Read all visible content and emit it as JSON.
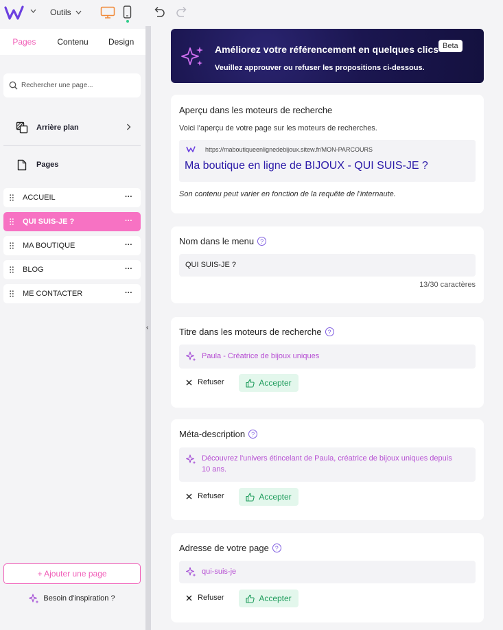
{
  "topbar": {
    "tools_label": "Outils"
  },
  "sidebar": {
    "tabs": [
      {
        "label": "Pages"
      },
      {
        "label": "Contenu"
      },
      {
        "label": "Design"
      }
    ],
    "search_placeholder": "Rechercher une page...",
    "background_label": "Arrière plan",
    "pages_label": "Pages",
    "pages": [
      {
        "label": "ACCUEIL"
      },
      {
        "label": "QUI SUIS-JE ?"
      },
      {
        "label": "MA BOUTIQUE"
      },
      {
        "label": "BLOG"
      },
      {
        "label": "ME CONTACTER"
      }
    ],
    "add_page_label": "+ Ajouter une page",
    "inspiration_label": "Besoin d'inspiration ?"
  },
  "banner": {
    "title": "Améliorez votre référencement en quelques clics",
    "subtitle": "Veuillez approuver ou refuser les propositions ci-dessous.",
    "badge": "Beta"
  },
  "preview_card": {
    "title": "Aperçu dans les moteurs de recherche",
    "description": "Voici l'aperçu de votre page sur les moteurs de recherches.",
    "url": "https://maboutiqueenlignedebijoux.sitew.fr/MON-PARCOURS",
    "page_title": "Ma boutique en ligne de BIJOUX - QUI SUIS-JE ?",
    "note": "Son contenu peut varier en fonction de la requête de l'internaute."
  },
  "menu_name_card": {
    "title": "Nom dans le menu",
    "value": "QUI SUIS-JE ?",
    "counter": "13/30 caractères"
  },
  "seo_title_card": {
    "title": "Titre dans les moteurs de recherche",
    "suggestion": "Paula - Créatrice de bijoux uniques",
    "refuse_label": "Refuser",
    "accept_label": "Accepter"
  },
  "meta_card": {
    "title": "Méta-description",
    "suggestion": "Découvrez l'univers étincelant de Paula, créatrice de bijoux uniques depuis 10 ans.",
    "refuse_label": "Refuser",
    "accept_label": "Accepter"
  },
  "address_card": {
    "title": "Adresse de votre page",
    "suggestion": "qui-suis-je",
    "refuse_label": "Refuser",
    "accept_label": "Accepter"
  },
  "colors": {
    "accent_pink": "#f05fb8",
    "active_page_bg": "#f772c3",
    "banner_bg": "#1b1650",
    "link_blue": "#2b1aa8",
    "suggestion_purple": "#b64ed3",
    "accept_green": "#1e9c5c"
  }
}
